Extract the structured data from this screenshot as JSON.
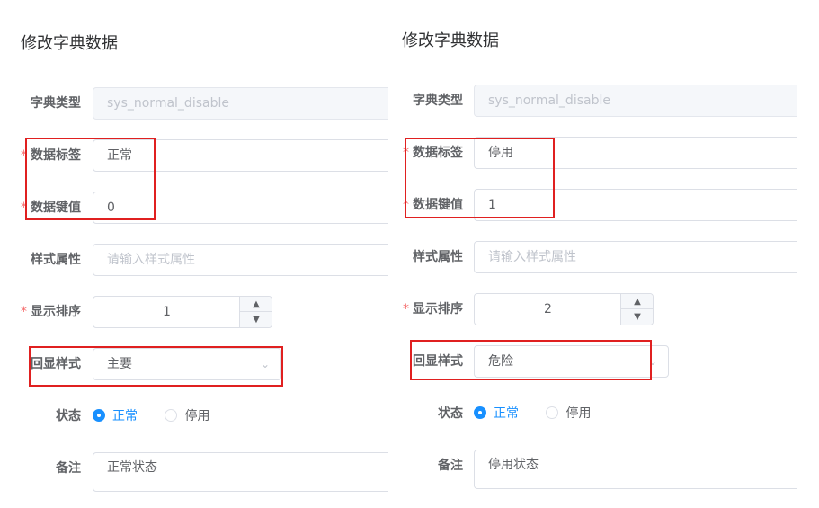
{
  "labels": {
    "dict_type": "字典类型",
    "data_label": "数据标签",
    "data_value": "数据键值",
    "css_class": "样式属性",
    "sort": "显示排序",
    "list_class": "回显样式",
    "status": "状态",
    "remark": "备注"
  },
  "required_mark": "*",
  "panels": [
    {
      "title": "修改字典数据",
      "dict_type": "sys_normal_disable",
      "data_label": "正常",
      "data_value": "0",
      "css_class_placeholder": "请输入样式属性",
      "sort": "1",
      "list_class": "主要",
      "status_options": [
        "正常",
        "停用"
      ],
      "status_selected": "正常",
      "remark": "正常状态"
    },
    {
      "title": "修改字典数据",
      "dict_type": "sys_normal_disable",
      "data_label": "停用",
      "data_value": "1",
      "css_class_placeholder": "请输入样式属性",
      "sort": "2",
      "list_class": "危险",
      "status_options": [
        "正常",
        "停用"
      ],
      "status_selected": "正常",
      "remark": "停用状态"
    }
  ],
  "icons": {
    "up": "▲",
    "down": "▼",
    "select": "chevron-down-icon"
  },
  "highlight_color": "#e02020",
  "accent_color": "#1890ff"
}
